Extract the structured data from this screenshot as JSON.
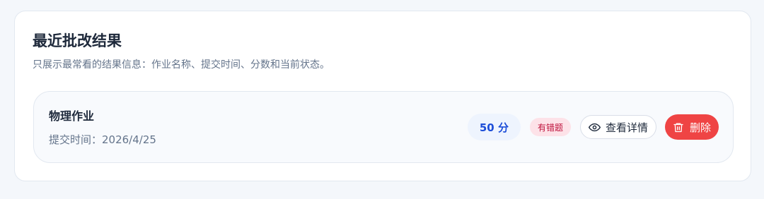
{
  "section": {
    "title": "最近批改结果",
    "subtitle": "只展示最常看的结果信息：作业名称、提交时间、分数和当前状态。"
  },
  "result": {
    "name": "物理作业",
    "submit_time": "提交时间：2026/4/25",
    "score": "50 分",
    "status": "有错题",
    "view_label": "查看详情",
    "delete_label": "删除"
  },
  "icons": {
    "view": "eye-icon",
    "delete": "trash-icon"
  },
  "colors": {
    "score_text": "#1d4ed8",
    "status_text": "#be123c",
    "delete_bg": "#ef4444"
  }
}
